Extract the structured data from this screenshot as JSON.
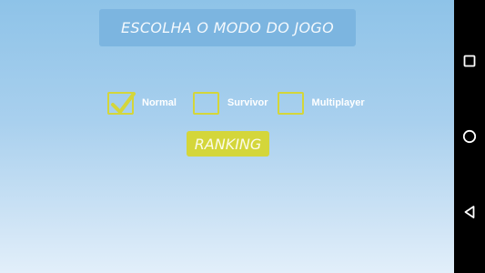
{
  "header": {
    "title": "ESCOLHA O MODO DO JOGO"
  },
  "modes": [
    {
      "label": "Normal",
      "checked": true
    },
    {
      "label": "Survivor",
      "checked": false
    },
    {
      "label": "Multiplayer",
      "checked": false
    }
  ],
  "ranking": {
    "label": "RANKING"
  },
  "navbar": {
    "icons": [
      "recents-square-icon",
      "home-circle-icon",
      "back-triangle-icon"
    ]
  },
  "colors": {
    "accent": "#d4d63a",
    "header_bg": "#7cb5e0",
    "background_top": "#8ec3e8",
    "background_bottom": "#e2effa",
    "navbar": "#000000"
  }
}
